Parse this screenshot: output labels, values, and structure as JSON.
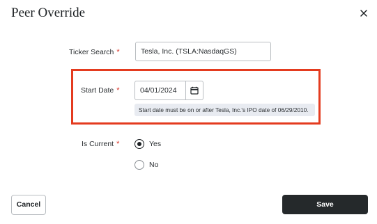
{
  "dialog": {
    "title": "Peer Override",
    "close_icon": "close-icon"
  },
  "ticker_search": {
    "label": "Ticker Search",
    "required_marker": "*",
    "value": "Tesla, Inc. (TSLA:NasdaqGS)"
  },
  "start_date": {
    "label": "Start Date",
    "required_marker": "*",
    "value": "04/01/2024",
    "calendar_icon": "calendar-icon",
    "hint": "Start date must be on or after Tesla, Inc.'s IPO date of 06/29/2010.",
    "highlight_color": "#e43b1f"
  },
  "is_current": {
    "label": "Is Current",
    "required_marker": "*",
    "options": [
      {
        "label": "Yes",
        "selected": true
      },
      {
        "label": "No",
        "selected": false
      }
    ]
  },
  "footer": {
    "cancel_label": "Cancel",
    "save_label": "Save",
    "save_color": "#25292b"
  }
}
